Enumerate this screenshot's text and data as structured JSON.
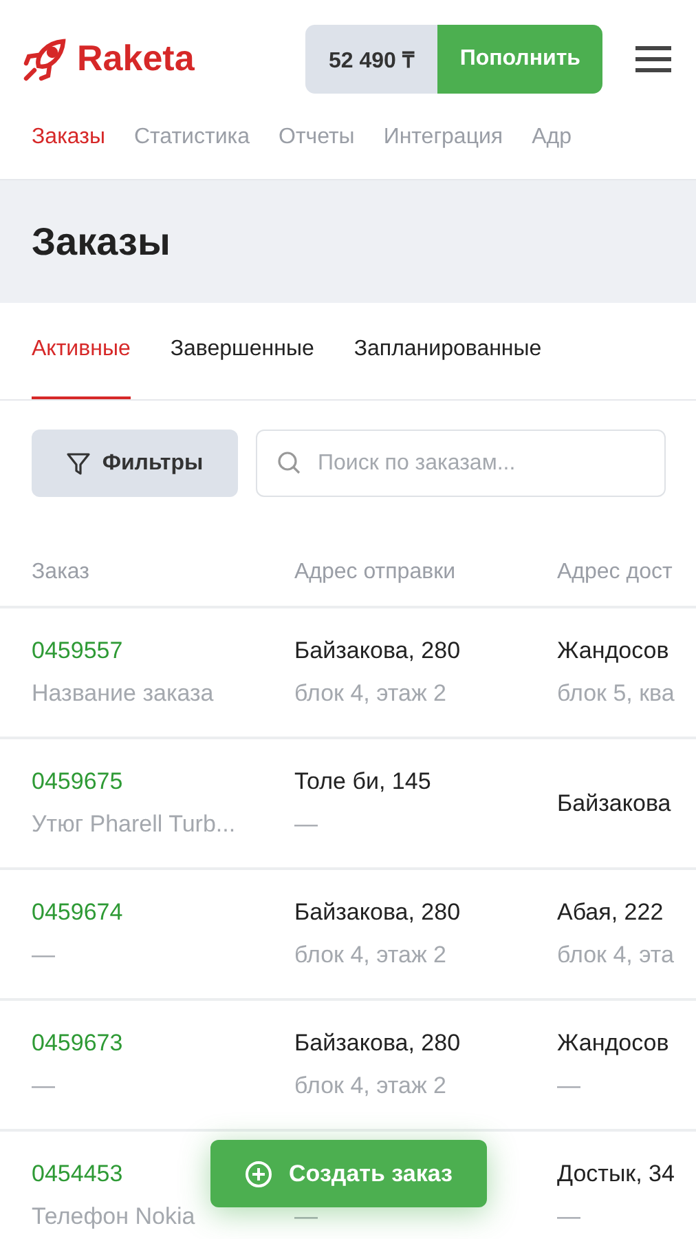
{
  "header": {
    "logo": "Raketa",
    "balance": "52 490 ₸",
    "topup_button": "Пополнить"
  },
  "nav": [
    {
      "label": "Заказы",
      "selected": true
    },
    {
      "label": "Статистика",
      "selected": false
    },
    {
      "label": "Отчеты",
      "selected": false
    },
    {
      "label": "Интеграция",
      "selected": false
    },
    {
      "label": "Адр",
      "selected": false
    }
  ],
  "page_title": "Заказы",
  "tabs": [
    {
      "label": "Активные",
      "selected": true
    },
    {
      "label": "Завершенные",
      "selected": false
    },
    {
      "label": "Запланированные",
      "selected": false
    }
  ],
  "filters_button": "Фильтры",
  "search": {
    "placeholder": "Поиск по заказам..."
  },
  "table": {
    "columns": [
      "Заказ",
      "Адрес отправки",
      "Адрес дост"
    ],
    "rows": [
      {
        "order": {
          "number": "0459557",
          "name": "Название заказа"
        },
        "from": {
          "line1": "Байзакова, 280",
          "line2": "блок 4, этаж 2"
        },
        "to": {
          "line1": "Жандосов",
          "line2": "блок 5, ква"
        }
      },
      {
        "order": {
          "number": "0459675",
          "name": "Утюг Pharell Turb..."
        },
        "from": {
          "line1": "Толе би, 145",
          "line2": "—"
        },
        "to": {
          "line1": "Байзакова"
        }
      },
      {
        "order": {
          "number": "0459674",
          "name": "—"
        },
        "from": {
          "line1": "Байзакова, 280",
          "line2": "блок 4, этаж 2"
        },
        "to": {
          "line1": "Абая, 222",
          "line2": "блок 4, эта"
        }
      },
      {
        "order": {
          "number": "0459673",
          "name": "—"
        },
        "from": {
          "line1": "Байзакова, 280",
          "line2": "блок 4, этаж 2"
        },
        "to": {
          "line1": "Жандосов",
          "line2": "—"
        }
      },
      {
        "order": {
          "number": "0454453",
          "name": "Телефон Nokia"
        },
        "from": {
          "line2": "—"
        },
        "to": {
          "line1": "Достык, 34",
          "line2": "—"
        }
      }
    ]
  },
  "create_button": "Создать заказ"
}
